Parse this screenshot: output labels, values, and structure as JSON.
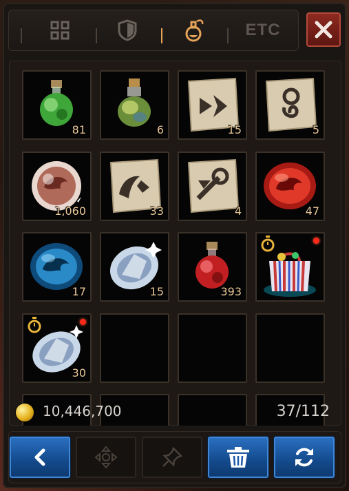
{
  "tabs": [
    {
      "name": "all",
      "icon": "grid-icon",
      "active": false
    },
    {
      "name": "equipment",
      "icon": "shield-icon",
      "active": false
    },
    {
      "name": "consumables",
      "icon": "potion-icon",
      "active": true
    },
    {
      "name": "etc",
      "label": "ETC",
      "active": false
    }
  ],
  "close_icon": "close-icon",
  "slots": [
    {
      "item": "green-potion",
      "count": "81"
    },
    {
      "item": "rainbow-potion",
      "count": "6"
    },
    {
      "item": "scroll-teleport",
      "count": "15"
    },
    {
      "item": "scroll-return",
      "count": "5"
    },
    {
      "item": "dragon-orb-white",
      "count": "1,060"
    },
    {
      "item": "scroll-blessing",
      "count": "33"
    },
    {
      "item": "scroll-enchant",
      "count": "4"
    },
    {
      "item": "dragon-gem-red",
      "count": "47"
    },
    {
      "item": "dragon-gem-blue",
      "count": "17"
    },
    {
      "item": "diamond",
      "count": "15"
    },
    {
      "item": "red-potion",
      "count": "393"
    },
    {
      "item": "gift-bag",
      "count": "",
      "timed": true,
      "new": true
    },
    {
      "item": "diamond-timed",
      "count": "30",
      "timed": true,
      "new": true
    },
    {
      "item": "",
      "count": ""
    },
    {
      "item": "",
      "count": ""
    },
    {
      "item": "",
      "count": ""
    }
  ],
  "footer": {
    "gold": "10,446,700",
    "capacity": "37/112"
  },
  "buttons": [
    {
      "name": "back",
      "icon": "chevron-left-icon",
      "enabled": true
    },
    {
      "name": "move",
      "icon": "move-arrows-icon",
      "enabled": false
    },
    {
      "name": "pin",
      "icon": "pin-icon",
      "enabled": false
    },
    {
      "name": "discard",
      "icon": "trash-icon",
      "enabled": true
    },
    {
      "name": "refresh",
      "icon": "refresh-icon",
      "enabled": true
    }
  ],
  "colors": {
    "accent": "#e6a35a",
    "close_bg": "#8e2a20",
    "button_blue": "#2a6fc0",
    "count_text": "#e9c79a"
  }
}
